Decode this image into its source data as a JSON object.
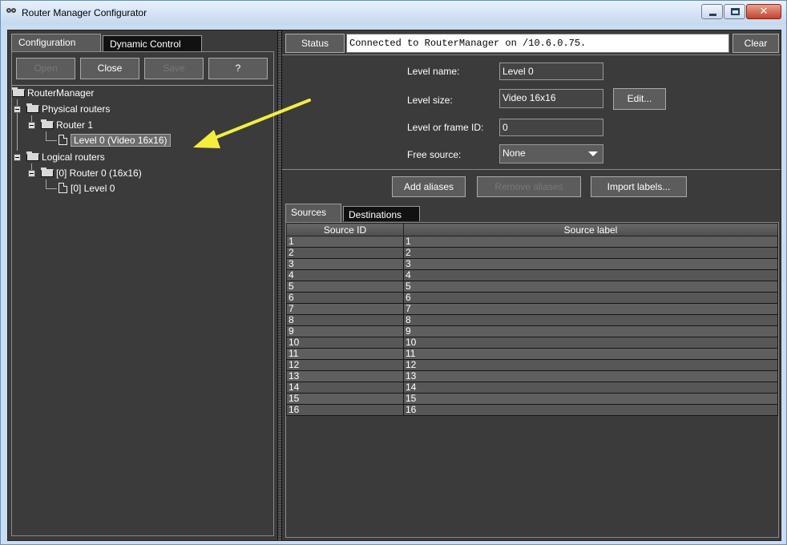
{
  "window": {
    "title": "Router Manager Configurator"
  },
  "left_tabs": [
    {
      "label": "Configuration"
    },
    {
      "label": "Dynamic Control"
    }
  ],
  "toolbar": {
    "open_label": "Open",
    "close_label": "Close",
    "save_label": "Save",
    "help_label": "?"
  },
  "tree": {
    "root": "RouterManager",
    "physical": "Physical routers",
    "router1": "Router 1",
    "level0": "Level 0 (Video 16x16)",
    "logical": "Logical routers",
    "router0": "[0] Router 0 (16x16)",
    "logical_level0": "[0] Level 0"
  },
  "status": {
    "button_label": "Status",
    "message": "Connected to RouterManager on /10.6.0.75.",
    "clear_label": "Clear"
  },
  "level_form": {
    "name_label": "Level name:",
    "name_value": "Level 0",
    "size_label": "Level size:",
    "size_value": "Video 16x16",
    "edit_label": "Edit...",
    "frame_id_label": "Level or frame ID:",
    "frame_id_value": "0",
    "free_source_label": "Free source:",
    "free_source_value": "None"
  },
  "aliases": {
    "add_label": "Add aliases",
    "remove_label": "Remove aliases",
    "import_label": "Import labels..."
  },
  "right_tabs": [
    {
      "label": "Sources"
    },
    {
      "label": "Destinations"
    }
  ],
  "table": {
    "headers": [
      "Source ID",
      "Source label"
    ],
    "rows": [
      [
        "1",
        "1"
      ],
      [
        "2",
        "2"
      ],
      [
        "3",
        "3"
      ],
      [
        "4",
        "4"
      ],
      [
        "5",
        "5"
      ],
      [
        "6",
        "6"
      ],
      [
        "7",
        "7"
      ],
      [
        "8",
        "8"
      ],
      [
        "9",
        "9"
      ],
      [
        "10",
        "10"
      ],
      [
        "11",
        "11"
      ],
      [
        "12",
        "12"
      ],
      [
        "13",
        "13"
      ],
      [
        "14",
        "14"
      ],
      [
        "15",
        "15"
      ],
      [
        "16",
        "16"
      ]
    ]
  },
  "colors": {
    "panel_bg": "#3b3b3b",
    "annotation_arrow": "#f2ef3a"
  }
}
